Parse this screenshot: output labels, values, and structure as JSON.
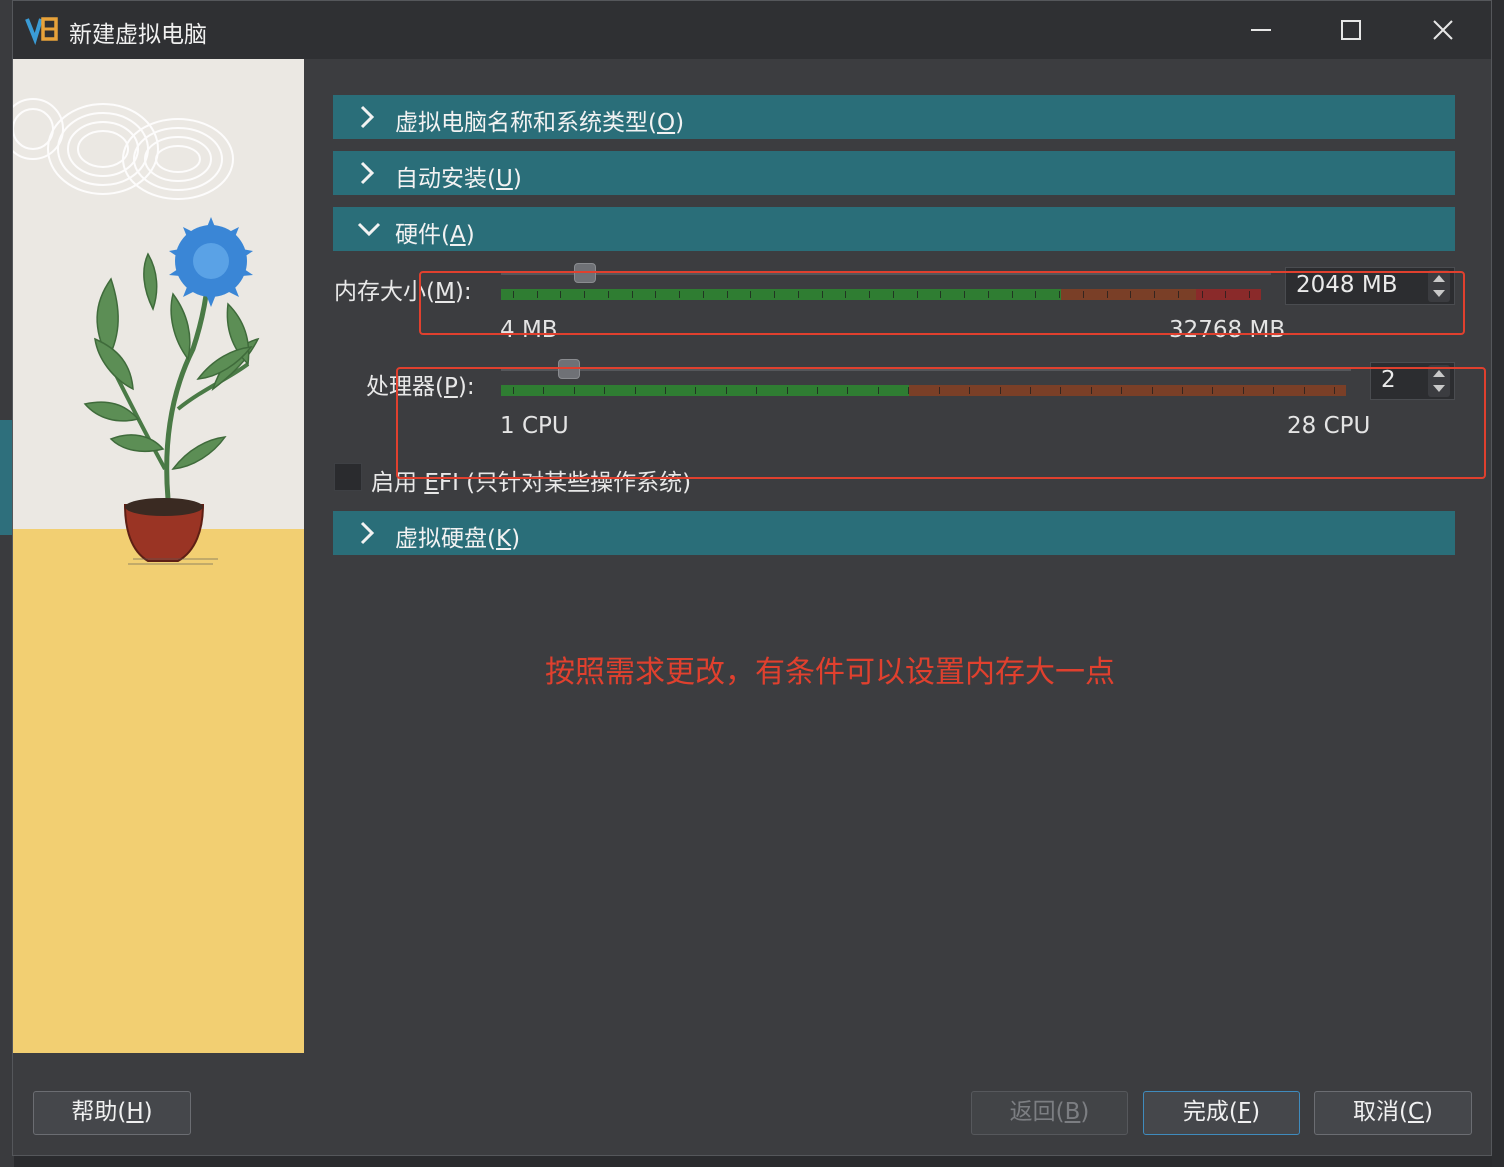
{
  "window": {
    "title": "新建虚拟电脑"
  },
  "sections": [
    {
      "label": "虚拟电脑名称和系统类型(O)",
      "text": "虚拟电脑名称和系统类型(",
      "key": "O",
      "tail": ")",
      "expanded": false
    },
    {
      "label": "自动安装(U)",
      "text": "自动安装(",
      "key": "U",
      "tail": ")",
      "expanded": false
    },
    {
      "label": "硬件(A)",
      "text": "硬件(",
      "key": "A",
      "tail": ")",
      "expanded": true
    },
    {
      "label": "虚拟硬盘(K)",
      "text": "虚拟硬盘(",
      "key": "K",
      "tail": ")",
      "expanded": false
    }
  ],
  "memory": {
    "label_text": "内存大小(",
    "label_key": "M",
    "label_tail": "):",
    "value": "2048 MB",
    "min_label": "4 MB",
    "max_label": "32768 MB",
    "fraction": 0.0624
  },
  "processor": {
    "label_text": "处理器(",
    "label_key": "P",
    "label_tail": "):",
    "value": "2",
    "min_label": "1 CPU",
    "max_label": "28 CPU",
    "fraction": 0.037
  },
  "efi": {
    "text": "启用 ",
    "key": "E",
    "tail": "FI (只针对某些操作系统)",
    "checked": false
  },
  "annotation": "按照需求更改，有条件可以设置内存大一点",
  "buttons": {
    "help": {
      "text": "帮助(",
      "key": "H",
      "tail": ")"
    },
    "back": {
      "text": "返回(",
      "key": "B",
      "tail": ")"
    },
    "finish": {
      "text": "完成(",
      "key": "F",
      "tail": ")"
    },
    "cancel": {
      "text": "取消(",
      "key": "C",
      "tail": ")"
    }
  },
  "colors": {
    "section_bar": "#2a6e79",
    "annotation": "#e0402e",
    "slider_green": "#2f7d32",
    "slider_orange": "#7a3f27",
    "slider_red": "#8a2a2a"
  }
}
